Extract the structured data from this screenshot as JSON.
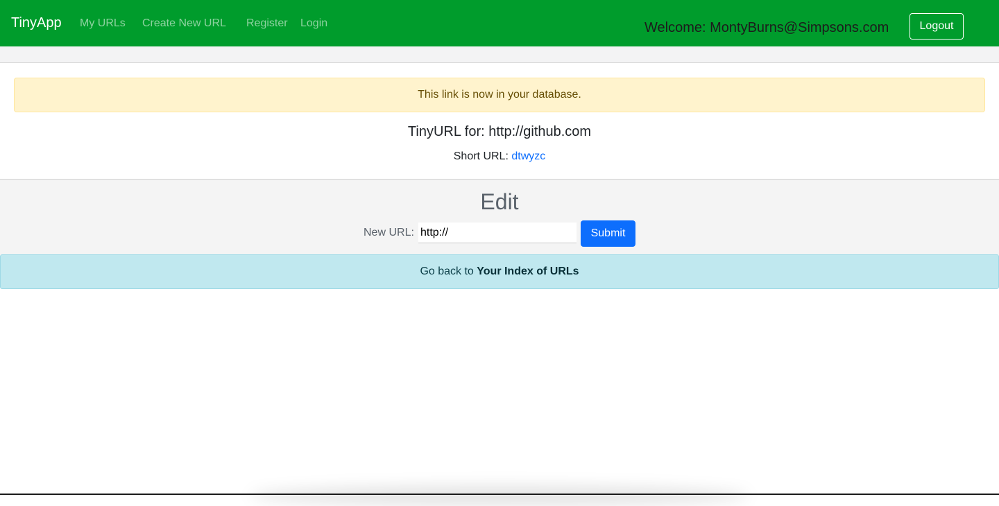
{
  "navbar": {
    "brand": "TinyApp",
    "links": [
      "My URLs",
      "Create New URL",
      "Register",
      "Login"
    ],
    "welcome": "Welcome: MontyBurns@Simpsons.com",
    "logout_label": "Logout"
  },
  "alert": {
    "message": "This link is now in your database."
  },
  "url_info": {
    "heading": "TinyURL for: http://github.com",
    "short_prefix": "Short URL:",
    "short_code": "dtwyzc"
  },
  "edit": {
    "title": "Edit",
    "new_url_label": "New URL:",
    "new_url_value": "http://",
    "submit_label": "Submit"
  },
  "back": {
    "prefix": "Go back to",
    "link_label": "Your Index of URLs"
  },
  "colors": {
    "navbar_bg": "#009c2c",
    "primary": "#0d6efd",
    "warning_bg": "#fff3cd",
    "info_bg": "#c0e8ef"
  }
}
